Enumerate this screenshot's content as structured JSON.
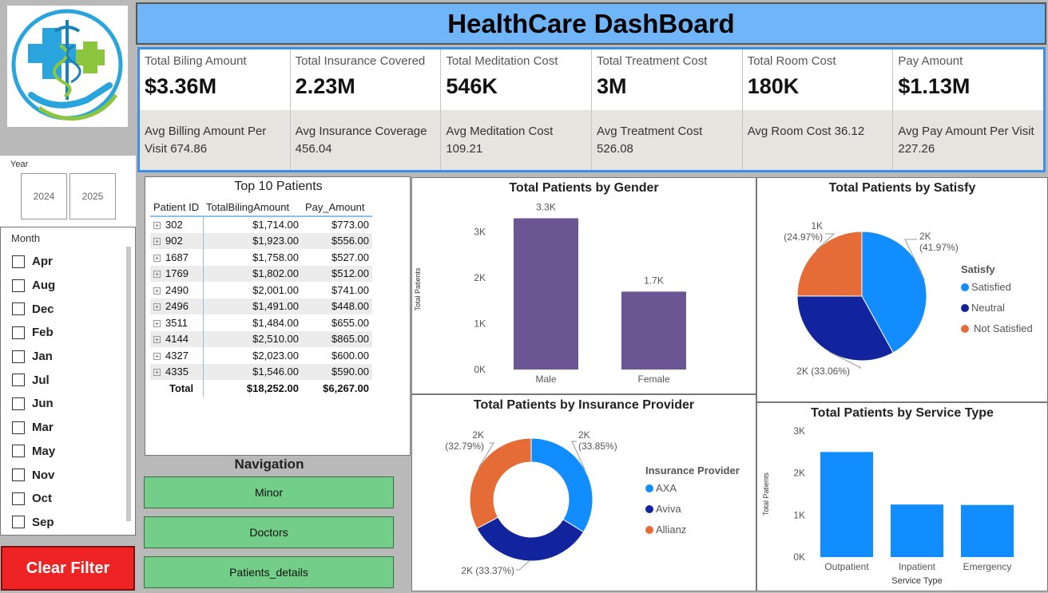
{
  "header": {
    "title": "HealthCare DashBoard"
  },
  "logo": {
    "name": "medical-caduceus-logo"
  },
  "year_slicer": {
    "title": "Year",
    "options": [
      "2024",
      "2025"
    ]
  },
  "month_slicer": {
    "title": "Month",
    "options": [
      "Apr",
      "Aug",
      "Dec",
      "Feb",
      "Jan",
      "Jul",
      "Jun",
      "Mar",
      "May",
      "Nov",
      "Oct",
      "Sep"
    ]
  },
  "clear_filter": {
    "label": "Clear Filter"
  },
  "kpis": [
    {
      "label": "Total Biling Amount",
      "value": "$3.36M",
      "sub": "Avg Billing Amount Per Visit 674.86"
    },
    {
      "label": "Total Insurance Covered",
      "value": "2.23M",
      "sub": "Avg Insurance Coverage 456.04"
    },
    {
      "label": "Total Meditation Cost",
      "value": "546K",
      "sub": "Avg Meditation Cost 109.21"
    },
    {
      "label": "Total Treatment Cost",
      "value": "3M",
      "sub": "Avg Treatment Cost 526.08"
    },
    {
      "label": "Total Room Cost",
      "value": "180K",
      "sub": "Avg Room Cost 36.12"
    },
    {
      "label": "Pay Amount",
      "value": "$1.13M",
      "sub": "Avg Pay Amount Per Visit 227.26"
    }
  ],
  "top_patients": {
    "title": "Top 10 Patients",
    "columns": [
      "Patient ID",
      "TotalBilingAmount",
      "Pay_Amount"
    ],
    "rows": [
      [
        "302",
        "$1,714.00",
        "$773.00"
      ],
      [
        "902",
        "$1,923.00",
        "$556.00"
      ],
      [
        "1687",
        "$1,758.00",
        "$527.00"
      ],
      [
        "1769",
        "$1,802.00",
        "$512.00"
      ],
      [
        "2490",
        "$2,001.00",
        "$741.00"
      ],
      [
        "2496",
        "$1,491.00",
        "$448.00"
      ],
      [
        "3511",
        "$1,484.00",
        "$655.00"
      ],
      [
        "4144",
        "$2,510.00",
        "$865.00"
      ],
      [
        "4327",
        "$2,023.00",
        "$600.00"
      ],
      [
        "4335",
        "$1,546.00",
        "$590.00"
      ]
    ],
    "total": [
      "Total",
      "$18,252.00",
      "$6,267.00"
    ]
  },
  "navigation": {
    "title": "Navigation",
    "buttons": [
      "Minor",
      "Doctors",
      "Patients_details"
    ]
  },
  "chart_data": [
    {
      "id": "gender",
      "type": "bar",
      "title": "Total Patients by Gender",
      "ylabel": "Total Patients",
      "categories": [
        "Male",
        "Female"
      ],
      "values": [
        3300,
        1700
      ],
      "data_labels": [
        "3.3K",
        "1.7K"
      ],
      "ylim": [
        0,
        3500
      ],
      "yticks": [
        0,
        1000,
        2000,
        3000
      ],
      "ytick_labels": [
        "0K",
        "1K",
        "2K",
        "3K"
      ],
      "color": "#6b5693"
    },
    {
      "id": "satisfy",
      "type": "pie",
      "title": "Total Patients by Satisfy",
      "legend_title": "Satisfy",
      "legend_position": "right",
      "labels": [
        "Satisfied",
        "Neutral",
        "Not Satisfied"
      ],
      "values": [
        41.97,
        33.06,
        24.97
      ],
      "data_labels": [
        "2K\n(41.97%)",
        "2K (33.06%)",
        "1K\n(24.97%)"
      ],
      "colors": [
        "#118dff",
        "#12239e",
        "#e66c37"
      ]
    },
    {
      "id": "insurance",
      "type": "pie",
      "donut": true,
      "title": "Total Patients by Insurance Provider",
      "legend_title": "Insurance Provider",
      "legend_position": "right",
      "labels": [
        "AXA",
        "Aviva",
        "Allianz"
      ],
      "values": [
        33.85,
        33.37,
        32.79
      ],
      "data_labels": [
        "2K\n(33.85%)",
        "2K (33.37%)",
        "2K\n(32.79%)"
      ],
      "colors": [
        "#118dff",
        "#12239e",
        "#e66c37"
      ]
    },
    {
      "id": "service",
      "type": "bar",
      "title": "Total Patients by Service Type",
      "xlabel": "Service Type",
      "ylabel": "Total Patients",
      "categories": [
        "Outpatient",
        "Inpatient",
        "Emergency"
      ],
      "values": [
        2500,
        1250,
        1240
      ],
      "ylim": [
        0,
        3000
      ],
      "yticks": [
        0,
        1000,
        2000,
        3000
      ],
      "ytick_labels": [
        "0K",
        "1K",
        "2K",
        "3K"
      ],
      "color": "#118dff"
    }
  ]
}
